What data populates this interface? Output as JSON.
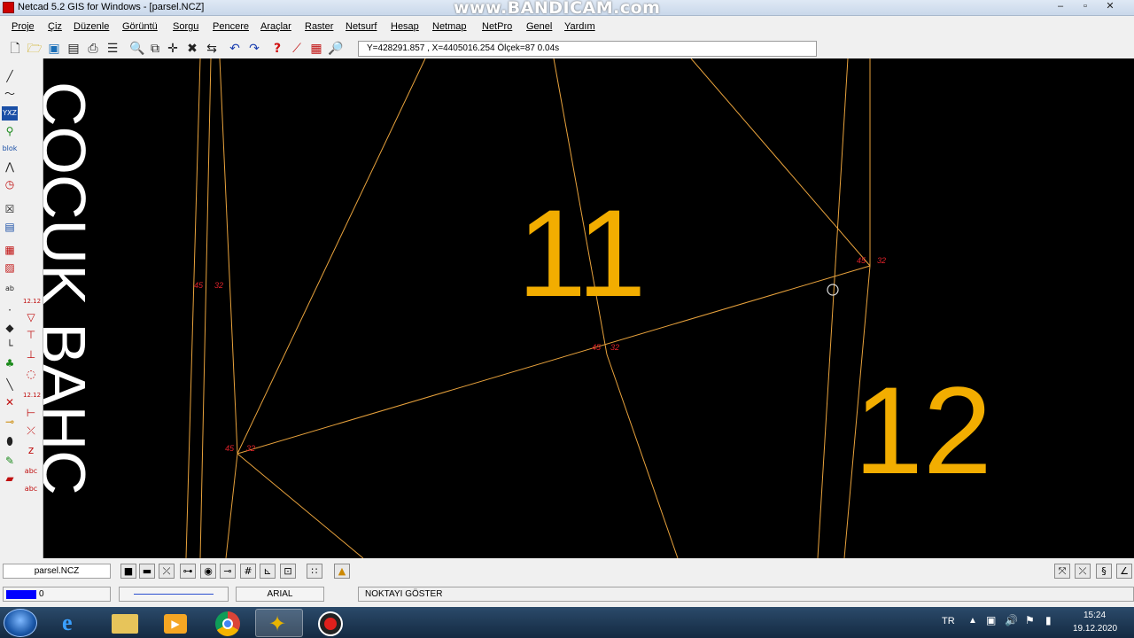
{
  "window": {
    "title": "Netcad 5.2 GIS for Windows - [parsel.NCZ]",
    "watermark": "www.BANDICAM.com",
    "controls": {
      "minimize": "–",
      "restore": "▫",
      "close": "✕"
    }
  },
  "menu": [
    "Proje",
    "Çiz",
    "Düzenle",
    "Görüntü",
    "Sorgu",
    "Pencere",
    "Araçlar",
    "Raster",
    "Netsurf",
    "Hesap",
    "Netmap",
    "NetPro",
    "Genel",
    "Yardım"
  ],
  "coordinates": "Y=428291.857 , X=4405016.254 Ölçek=87   0.04s",
  "drawing": {
    "label_side": "ÇOCUK BAHÇ",
    "parcel_a": "11",
    "parcel_b": "12",
    "point_labels": [
      "45",
      "32",
      "45",
      "32",
      "45",
      "32",
      "45",
      "32"
    ],
    "colors": {
      "line": "#e8a23c",
      "parcel_text": "#f2ad00",
      "point_text": "#e0222a",
      "side_text": "#ffffff"
    }
  },
  "statusbar": {
    "file_tab": "parsel.NCZ",
    "layer_value": "0",
    "font_name": "ARIAL",
    "message": "NOKTAYI GÖSTER",
    "layer_color": "#0000ff"
  },
  "taskbar": {
    "language": "TR",
    "time": "15:24",
    "date": "19.12.2020"
  }
}
